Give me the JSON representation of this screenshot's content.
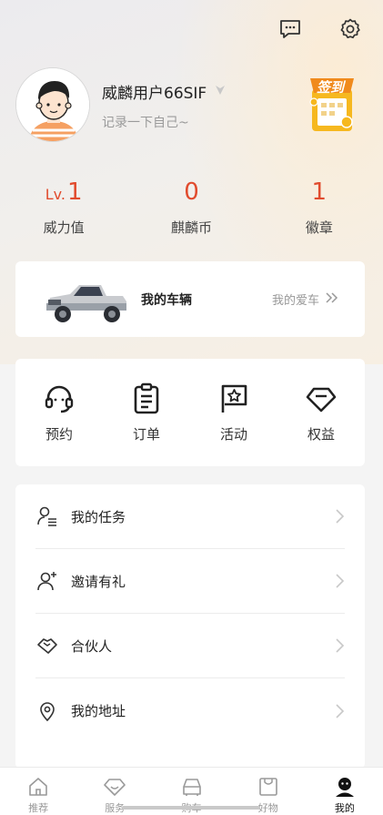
{
  "header": {
    "icons": [
      "message-icon",
      "settings-icon"
    ]
  },
  "profile": {
    "username": "威麟用户66SIF",
    "gender_icon": "gender-icon",
    "bio": "记录一下自己~",
    "checkin_label": "签到"
  },
  "stats": [
    {
      "prefix": "Lv.",
      "value": "1",
      "label": "威力值"
    },
    {
      "prefix": "",
      "value": "0",
      "label": "麒麟币"
    },
    {
      "prefix": "",
      "value": "1",
      "label": "徽章"
    }
  ],
  "vehicle": {
    "title": "我的车辆",
    "link": "我的爱车",
    "link_icon": "double-chevron-right-icon"
  },
  "quick_actions": [
    {
      "label": "预约",
      "icon": "headset-icon"
    },
    {
      "label": "订单",
      "icon": "clipboard-icon"
    },
    {
      "label": "活动",
      "icon": "flag-icon"
    },
    {
      "label": "权益",
      "icon": "diamond-icon"
    }
  ],
  "menu": [
    {
      "label": "我的任务",
      "icon": "task-user-icon"
    },
    {
      "label": "邀请有礼",
      "icon": "invite-user-icon"
    },
    {
      "label": "合伙人",
      "icon": "handshake-icon"
    },
    {
      "label": "我的地址",
      "icon": "location-pin-icon"
    }
  ],
  "tabbar": [
    {
      "label": "推荐",
      "icon": "home-icon",
      "active": false
    },
    {
      "label": "服务",
      "icon": "service-icon",
      "active": false
    },
    {
      "label": "购车",
      "icon": "car-icon",
      "active": false
    },
    {
      "label": "好物",
      "icon": "shop-bag-icon",
      "active": false
    },
    {
      "label": "我的",
      "icon": "profile-icon",
      "active": true
    }
  ],
  "colors": {
    "accent": "#e14b2d",
    "checkin_yellow": "#f6b81f"
  }
}
